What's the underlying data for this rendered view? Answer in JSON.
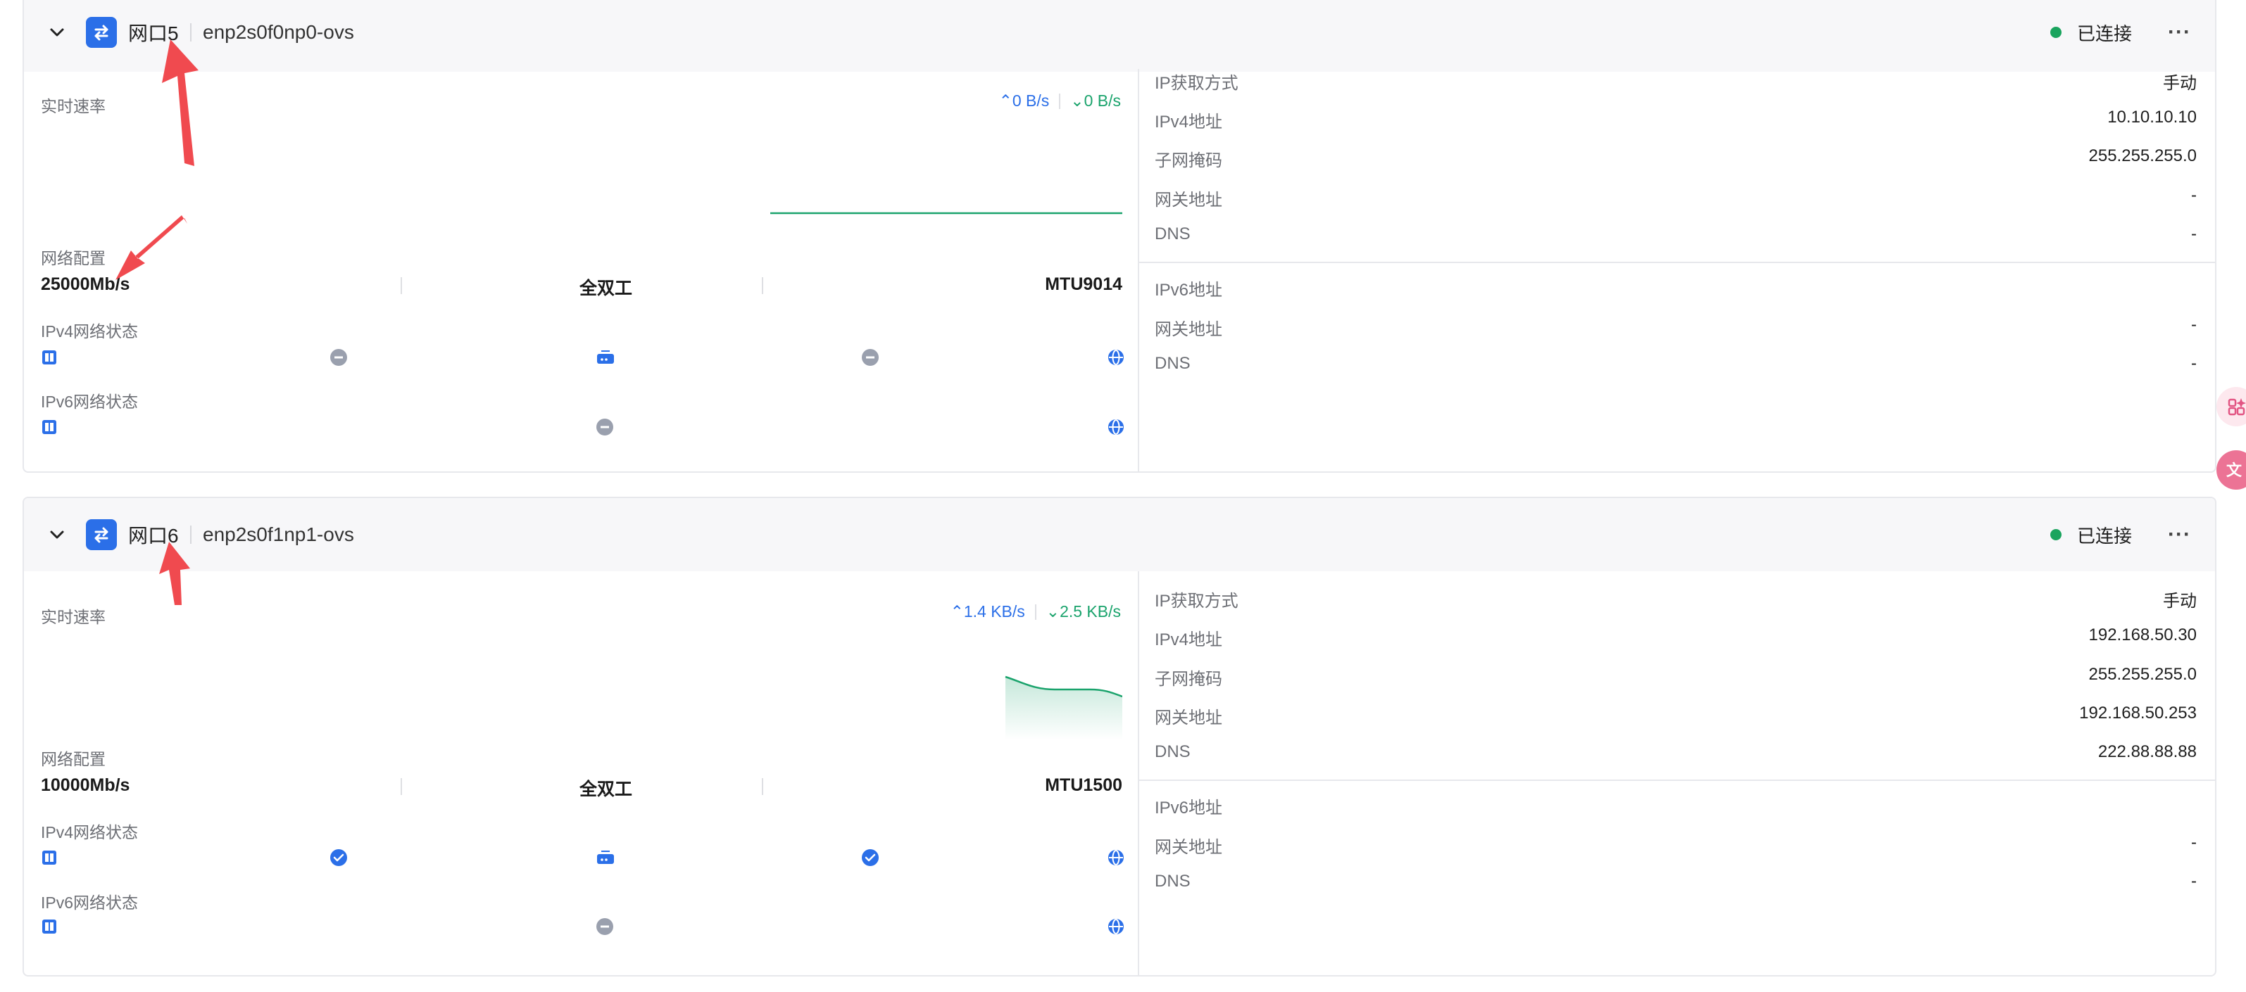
{
  "colors": {
    "accent": "#2b6fe8",
    "upload": "#2b6fe8",
    "download": "#1aa36c",
    "connected": "#1aa45e",
    "annotation_arrow": "#f04a4f"
  },
  "labels": {
    "realtime_rate": "实时速率",
    "net_config": "网络配置",
    "ipv4_status": "IPv4网络状态",
    "ipv6_status": "IPv6网络状态",
    "ip_method": "IP获取方式",
    "ipv4_addr": "IPv4地址",
    "subnet": "子网掩码",
    "gateway": "网关地址",
    "dns": "DNS",
    "ipv6_addr": "IPv6地址"
  },
  "ports": [
    {
      "name": "网口5",
      "iface": "enp2s0f0np0-ovs",
      "status": "已连接",
      "more": "···",
      "speed_up": "0 B/s",
      "speed_down": "0 B/s",
      "link_speed": "25000Mb/s",
      "duplex": "全双工",
      "mtu": "MTU9014",
      "ipv4_checks_ok": false,
      "ip_method": "手动",
      "ipv4_addr": "10.10.10.10",
      "subnet": "255.255.255.0",
      "gateway": "-",
      "dns": "-",
      "ipv6_addr": "",
      "ipv6_gateway": "-",
      "ipv6_dns": "-"
    },
    {
      "name": "网口6",
      "iface": "enp2s0f1np1-ovs",
      "status": "已连接",
      "more": "···",
      "speed_up": "1.4 KB/s",
      "speed_down": "2.5 KB/s",
      "link_speed": "10000Mb/s",
      "duplex": "全双工",
      "mtu": "MTU1500",
      "ipv4_checks_ok": true,
      "ip_method": "手动",
      "ipv4_addr": "192.168.50.30",
      "subnet": "255.255.255.0",
      "gateway": "192.168.50.253",
      "dns": "222.88.88.88",
      "ipv6_addr": "",
      "ipv6_gateway": "-",
      "ipv6_dns": "-"
    }
  ],
  "icons": {
    "chevron": "chevron-down-icon",
    "port": "swap-arrows-icon",
    "host": "server-icon",
    "router": "router-icon",
    "globe": "globe-icon",
    "check": "check-icon",
    "pending": "minus-icon"
  }
}
